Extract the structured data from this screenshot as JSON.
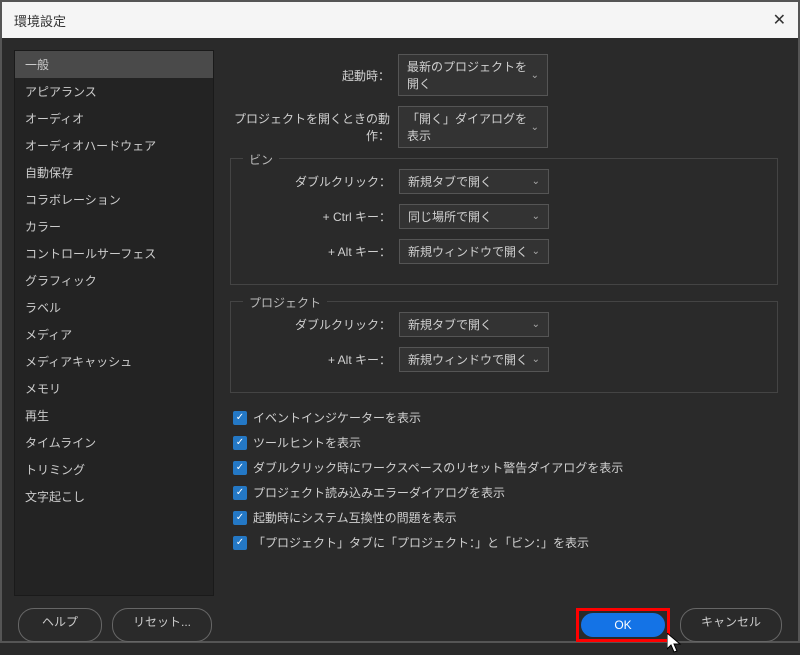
{
  "dialog_title": "環境設定",
  "sidebar": {
    "items": [
      "一般",
      "アピアランス",
      "オーディオ",
      "オーディオハードウェア",
      "自動保存",
      "コラボレーション",
      "カラー",
      "コントロールサーフェス",
      "グラフィック",
      "ラベル",
      "メディア",
      "メディアキャッシュ",
      "メモリ",
      "再生",
      "タイムライン",
      "トリミング",
      "文字起こし"
    ],
    "selected_index": 0
  },
  "main": {
    "startup_label": "起動時：",
    "startup_value": "最新のプロジェクトを開く",
    "open_project_label": "プロジェクトを開くときの動作：",
    "open_project_value": "「開く」ダイアログを表示",
    "bin": {
      "legend": "ビン",
      "dbl_label": "ダブルクリック：",
      "dbl_value": "新規タブで開く",
      "ctrl_label": "+ Ctrl キー：",
      "ctrl_value": "同じ場所で開く",
      "alt_label": "+ Alt キー：",
      "alt_value": "新規ウィンドウで開く"
    },
    "project": {
      "legend": "プロジェクト",
      "dbl_label": "ダブルクリック：",
      "dbl_value": "新規タブで開く",
      "alt_label": "+ Alt キー：",
      "alt_value": "新規ウィンドウで開く"
    },
    "checkboxes": [
      "イベントインジケーターを表示",
      "ツールヒントを表示",
      "ダブルクリック時にワークスペースのリセット警告ダイアログを表示",
      "プロジェクト読み込みエラーダイアログを表示",
      "起動時にシステム互換性の問題を表示",
      "「プロジェクト」タブに「プロジェクト：」と「ビン：」を表示"
    ]
  },
  "footer": {
    "help": "ヘルプ",
    "reset": "リセット...",
    "ok": "OK",
    "cancel": "キャンセル"
  }
}
